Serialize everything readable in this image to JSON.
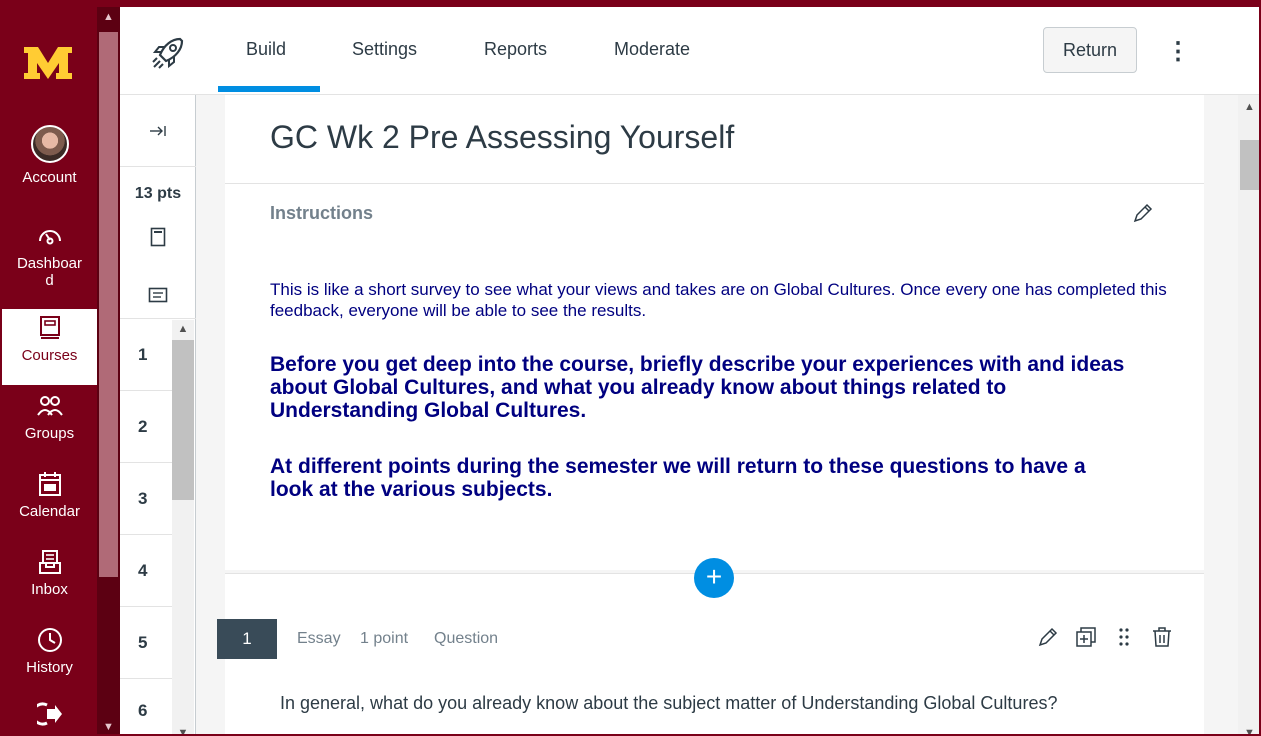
{
  "global_nav": {
    "logo": "M",
    "items": [
      {
        "label": "Account",
        "icon": "account-avatar-icon"
      },
      {
        "label": "Dashboar\nd",
        "icon": "dashboard-icon"
      },
      {
        "label": "Courses",
        "icon": "courses-icon",
        "active": true
      },
      {
        "label": "Groups",
        "icon": "groups-icon"
      },
      {
        "label": "Calendar",
        "icon": "calendar-icon"
      },
      {
        "label": "Inbox",
        "icon": "inbox-icon"
      },
      {
        "label": "History",
        "icon": "history-icon"
      },
      {
        "label": "",
        "icon": "logout-arrow-icon"
      }
    ]
  },
  "topbar": {
    "tabs": [
      "Build",
      "Settings",
      "Reports",
      "Moderate"
    ],
    "active_tab": "Build",
    "return_label": "Return"
  },
  "sidebar": {
    "points": "13 pts",
    "numbers": [
      "1",
      "2",
      "3",
      "4",
      "5",
      "6"
    ]
  },
  "quiz": {
    "title": "GC Wk 2 Pre Assessing Yourself",
    "instructions_label": "Instructions",
    "intro": "This is like a short survey to see what your views and takes are on Global Cultures. Once every one has completed this feedback, everyone will be able to see the results.",
    "paragraph1": "Before you get deep into the course, briefly describe your experiences with and ideas about Global Cultures, and what you already know about things related to Understanding Global Cultures.",
    "paragraph2": "At different points during the semester we will return to these questions to have a look at the various subjects.",
    "add_symbol": "+"
  },
  "question": {
    "number": "1",
    "type": "Essay",
    "points": "1 point",
    "kind": "Question",
    "text": "In general, what do you already know about the subject matter of Understanding Global Cultures?"
  },
  "colors": {
    "nav_bg": "#7a0019",
    "accent": "#008ee2",
    "instructions_text": "#000080"
  }
}
